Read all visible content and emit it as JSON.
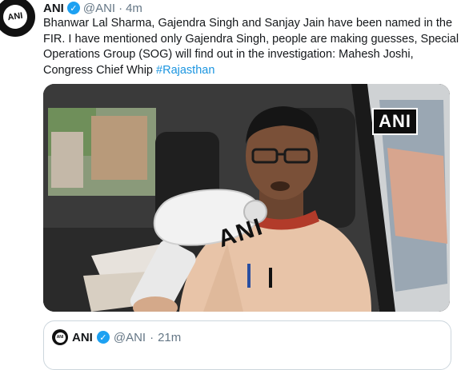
{
  "tweet": {
    "author_name": "ANI",
    "handle": "@ANI",
    "separator": "·",
    "time": "4m",
    "avatar_logo_text": "ANI",
    "text": "Bhanwar Lal Sharma, Gajendra Singh and Sanjay Jain have been named in the FIR. I have mentioned only Gajendra Singh, people are making guesses, Special Operations Group (SOG) will find out in the investigation: Mahesh Joshi, Congress Chief Whip ",
    "hashtag": "#Rajasthan",
    "media": {
      "watermark": "ANI",
      "mic_label": "ANI"
    }
  },
  "quoted_tweet": {
    "author_name": "ANI",
    "handle": "@ANI",
    "separator": "·",
    "time": "21m",
    "avatar_logo_text": "ANI"
  },
  "colors": {
    "link": "#1b95e0",
    "verified": "#1da1f2",
    "secondary_text": "#657786",
    "border": "#ccd6dd"
  },
  "icons": {
    "verified": "verified-badge-icon"
  }
}
